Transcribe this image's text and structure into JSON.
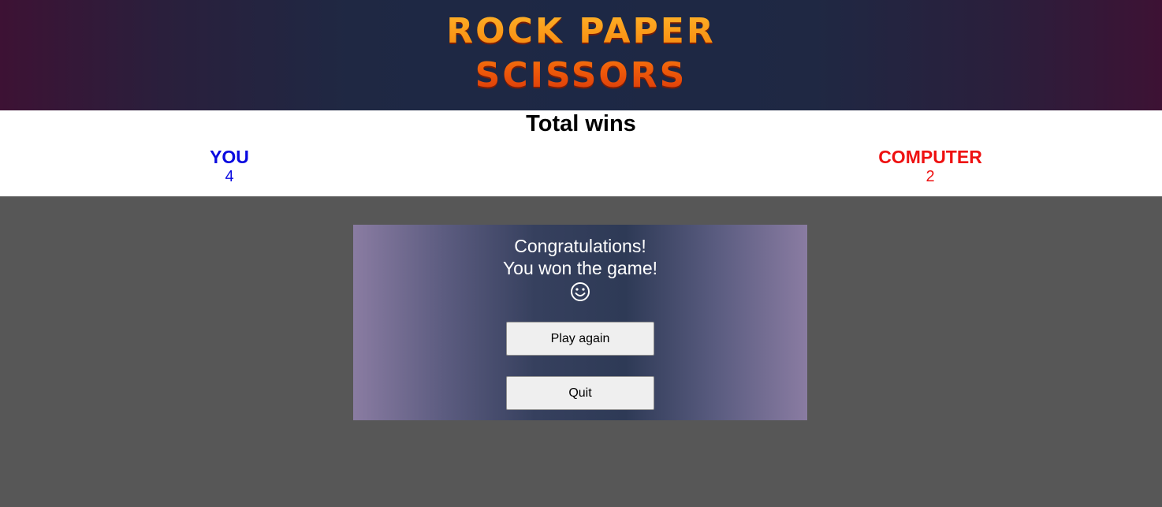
{
  "header": {
    "logo_line1": "ROCK PAPER",
    "logo_line2": "SCISSORS"
  },
  "scoreboard": {
    "title": "Total wins",
    "player": {
      "name": "YOU",
      "score": "4",
      "color": "#0a0ae0"
    },
    "computer": {
      "name": "COMPUTER",
      "score": "2",
      "color": "#ee1111"
    }
  },
  "result_modal": {
    "line1": "Congratulations!",
    "line2": "You won the game!",
    "icon": "smiley-face-icon",
    "play_again_label": "Play again",
    "quit_label": "Quit"
  }
}
